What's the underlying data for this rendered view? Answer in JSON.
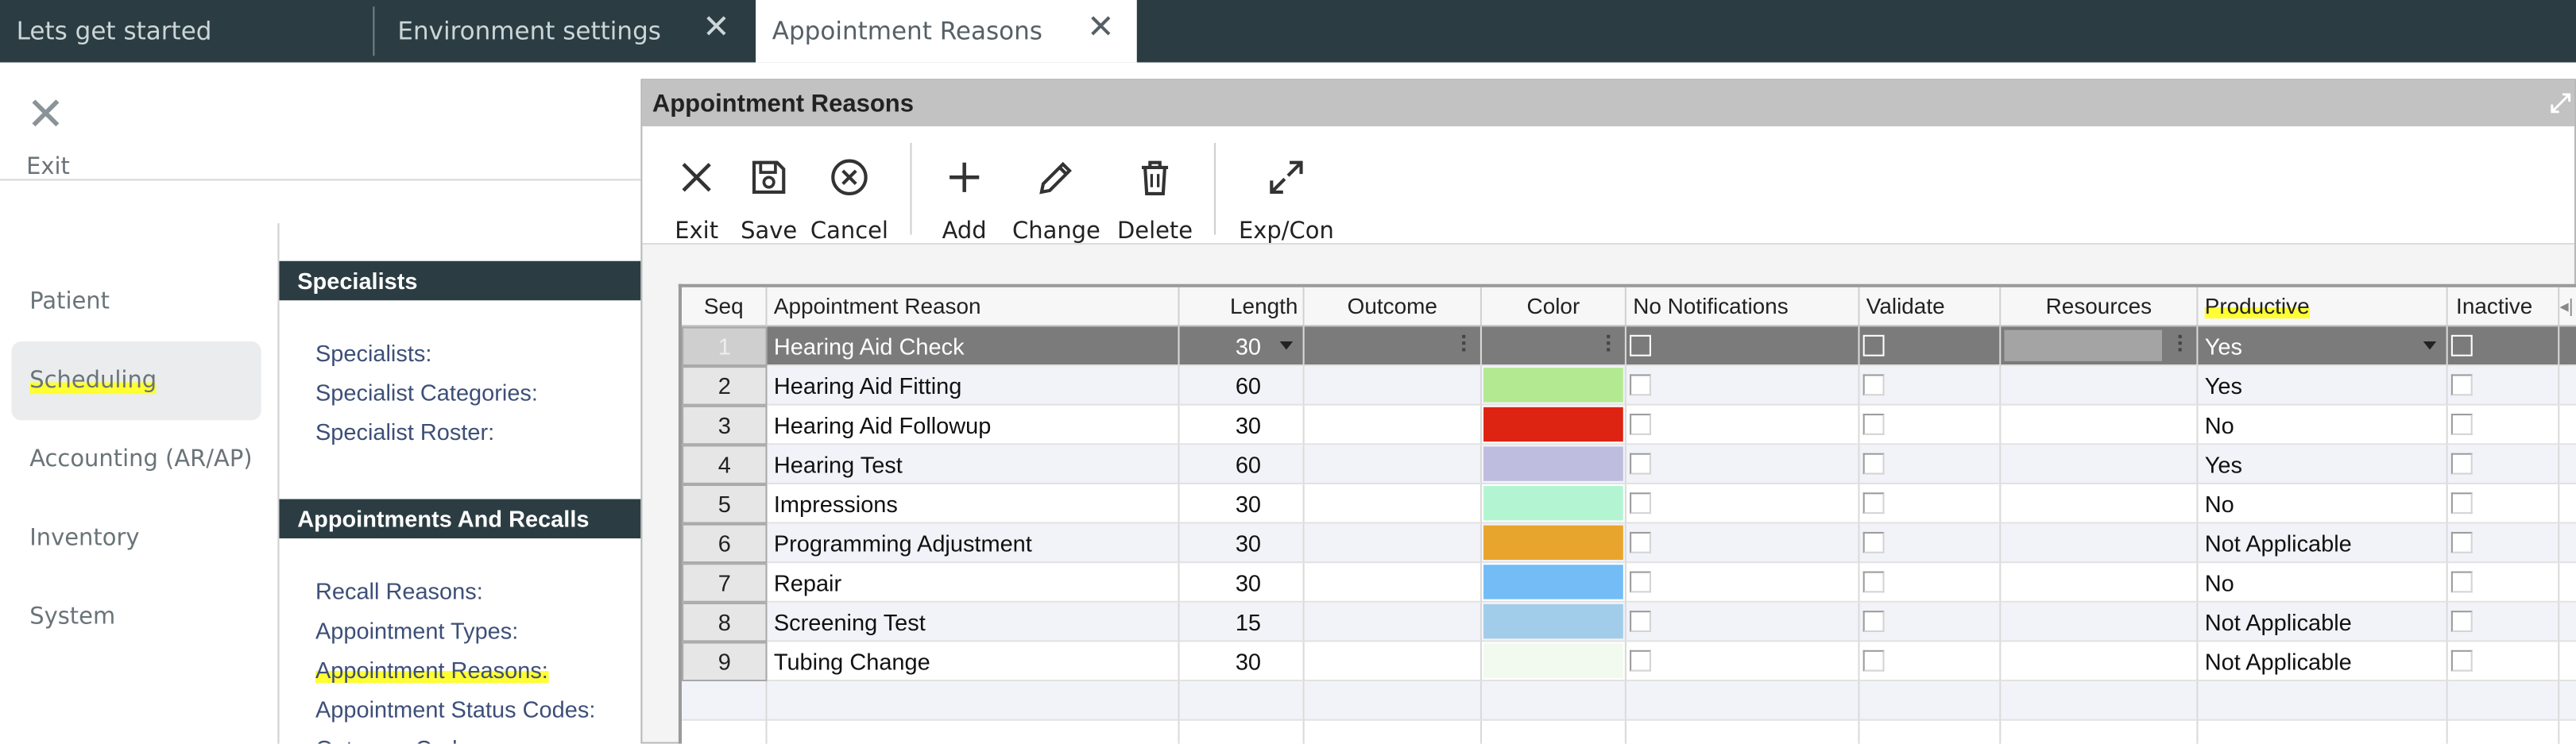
{
  "tabs": [
    {
      "label": "Lets get started",
      "closable": false,
      "active": false
    },
    {
      "label": "Environment settings",
      "closable": true,
      "active": false
    },
    {
      "label": "Appointment Reasons",
      "closable": true,
      "active": true
    }
  ],
  "left_exit": {
    "label": "Exit",
    "icon": "close-icon"
  },
  "nav": [
    {
      "label": "Patient",
      "selected": false
    },
    {
      "label": "Scheduling",
      "selected": true
    },
    {
      "label": "Accounting (AR/AP)",
      "selected": false
    },
    {
      "label": "Inventory",
      "selected": false
    },
    {
      "label": "System",
      "selected": false
    }
  ],
  "sections": {
    "specialists": {
      "title": "Specialists",
      "links": [
        "Specialists:",
        "Specialist Categories:",
        "Specialist Roster:"
      ]
    },
    "appointments": {
      "title": "Appointments And Recalls",
      "links": [
        "Recall Reasons:",
        "Appointment Types:",
        "Appointment Reasons:",
        "Appointment Status Codes:",
        "Outcome Codes:"
      ]
    }
  },
  "dialog": {
    "title": "Appointment Reasons",
    "toolbar": [
      {
        "label": "Exit",
        "icon": "close-icon"
      },
      {
        "label": "Save",
        "icon": "save-icon"
      },
      {
        "label": "Cancel",
        "icon": "cancel-circle-icon"
      },
      {
        "label": "Add",
        "icon": "plus-icon"
      },
      {
        "label": "Change",
        "icon": "pencil-icon"
      },
      {
        "label": "Delete",
        "icon": "trash-icon"
      },
      {
        "label": "Exp/Con",
        "icon": "expand-icon"
      }
    ]
  },
  "grid": {
    "columns": [
      "Seq",
      "Appointment Reason",
      "Length",
      "Outcome",
      "Color",
      "No Notifications",
      "Validate",
      "Resources",
      "Productive",
      "Inactive"
    ],
    "rows": [
      {
        "seq": "1",
        "reason": "Hearing Aid Check",
        "length": "30",
        "color": "#7b7b7b",
        "productive": "Yes",
        "selected": true
      },
      {
        "seq": "2",
        "reason": "Hearing Aid Fitting",
        "length": "60",
        "color": "#b3ea91",
        "productive": "Yes",
        "selected": false
      },
      {
        "seq": "3",
        "reason": "Hearing Aid Followup",
        "length": "30",
        "color": "#dd2412",
        "productive": "No",
        "selected": false
      },
      {
        "seq": "4",
        "reason": "Hearing Test",
        "length": "60",
        "color": "#bebde0",
        "productive": "Yes",
        "selected": false
      },
      {
        "seq": "5",
        "reason": "Impressions",
        "length": "30",
        "color": "#b3f5d2",
        "productive": "No",
        "selected": false
      },
      {
        "seq": "6",
        "reason": "Programming Adjustment",
        "length": "30",
        "color": "#e8a52d",
        "productive": "Not Applicable",
        "selected": false
      },
      {
        "seq": "7",
        "reason": "Repair",
        "length": "30",
        "color": "#73bcf6",
        "productive": "No",
        "selected": false
      },
      {
        "seq": "8",
        "reason": "Screening Test",
        "length": "15",
        "color": "#a2cdea",
        "productive": "Not Applicable",
        "selected": false
      },
      {
        "seq": "9",
        "reason": "Tubing Change",
        "length": "30",
        "color": "#f2faf0",
        "productive": "Not Applicable",
        "selected": false
      }
    ]
  },
  "colors": {
    "header_dark": "#2b3d42",
    "highlight": "#ffff33",
    "link": "#3d4f78",
    "selected_row": "#7b7b7b"
  }
}
